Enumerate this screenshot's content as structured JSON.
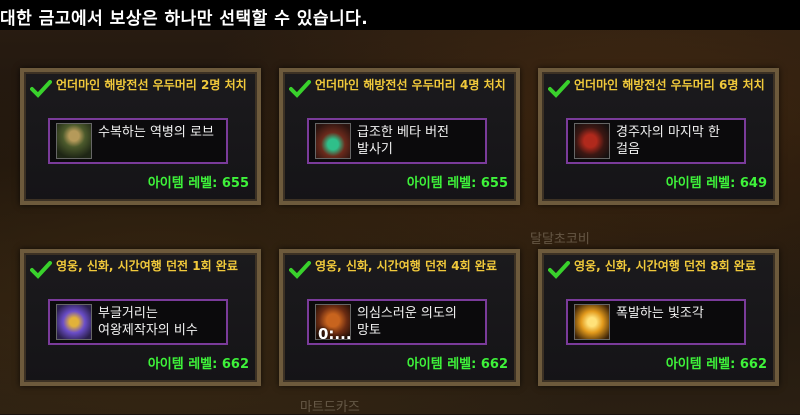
{
  "header": {
    "text": "대한 금고에서 보상은 하나만 선택할 수 있습니다."
  },
  "background": {
    "watermark_1": "달달초코비",
    "watermark_2": "마트드카즈"
  },
  "colors": {
    "title": "#f0c93b",
    "level": "#3ef23a",
    "item_border": "#7a3b9a",
    "check": "#39d12c"
  },
  "cards": [
    {
      "title": "언더마인 해방전선 우두머리 2명 처치",
      "item": "수복하는 역병의 로브",
      "level": "아이템 레벨: 655",
      "icon": "robe-icon"
    },
    {
      "title": "언더마인 해방전선 우두머리 4명 처치",
      "item": "급조한 베타 버전 발사기",
      "level": "아이템 레벨: 655",
      "icon": "launcher-icon"
    },
    {
      "title": "언더마인 해방전선 우두머리 6명 처치",
      "item": "경주자의 마지막 한 걸음",
      "level": "아이템 레벨: 649",
      "icon": "boots-icon"
    },
    {
      "title": "영웅, 신화, 시간여행 던전 1회 완료",
      "item": "부글거리는 여왕제작자의 비수",
      "level": "아이템 레벨: 662",
      "icon": "dagger-icon"
    },
    {
      "title": "영웅, 신화, 시간여행 던전 4회 완료",
      "item": "의심스러운 의도의 망토",
      "level": "아이템 레벨: 662",
      "icon": "cloak-icon",
      "overlay": "0:..."
    },
    {
      "title": "영웅, 신화, 시간여행 던전 8회 완료",
      "item": "폭발하는 빛조각",
      "level": "아이템 레벨: 662",
      "icon": "crystal-icon"
    }
  ]
}
